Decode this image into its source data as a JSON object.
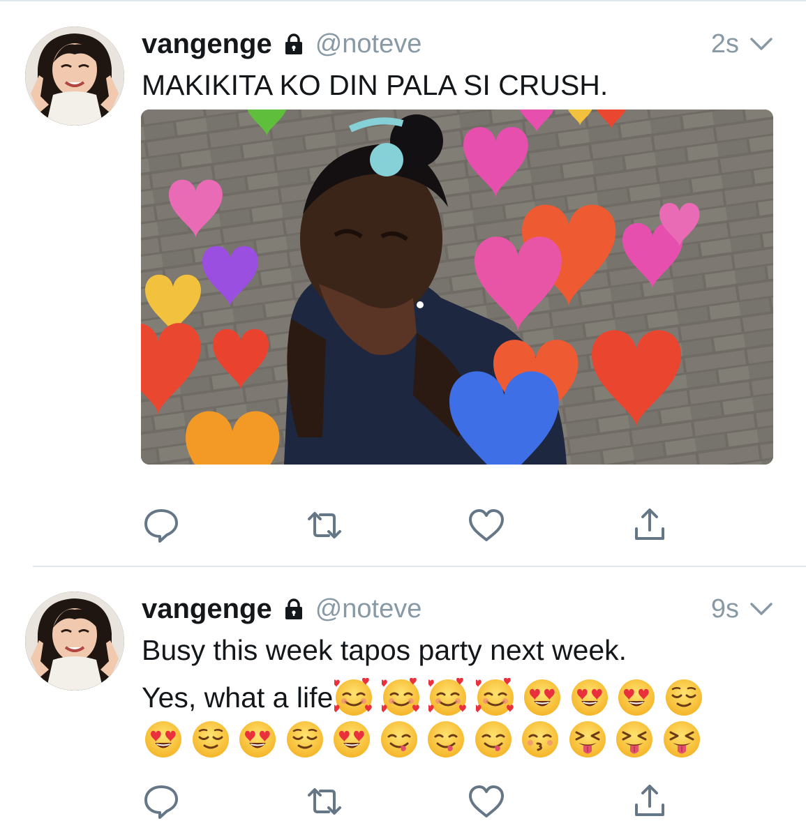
{
  "tweets": [
    {
      "display_name": "vangenge",
      "handle": "@noteve",
      "timestamp": "2s",
      "text": "MAKIKITA KO DIN PALA SI CRUSH.",
      "has_media": true
    },
    {
      "display_name": "vangenge",
      "handle": "@noteve",
      "timestamp": "9s",
      "text_line1": "Busy this week tapos party next week.",
      "text_line2": "Yes, what a life",
      "emoji_line2": [
        "smiling-face-with-hearts",
        "smiling-face-with-hearts",
        "smiling-face-with-hearts",
        "smiling-face-with-hearts",
        "heart-eyes",
        "heart-eyes",
        "heart-eyes",
        "relieved"
      ],
      "emoji_line3": [
        "heart-eyes",
        "relieved",
        "heart-eyes",
        "relieved",
        "heart-eyes",
        "yum",
        "yum",
        "yum",
        "kissing-closed-eyes",
        "squinting-tongue",
        "squinting-tongue",
        "squinting-tongue"
      ]
    }
  ],
  "action_icons": [
    "reply-icon",
    "retweet-icon",
    "like-icon",
    "share-icon"
  ],
  "colors": {
    "text": "#14171a",
    "secondary": "#8899a6",
    "icon": "#657786",
    "divider": "#e1e8ed"
  }
}
